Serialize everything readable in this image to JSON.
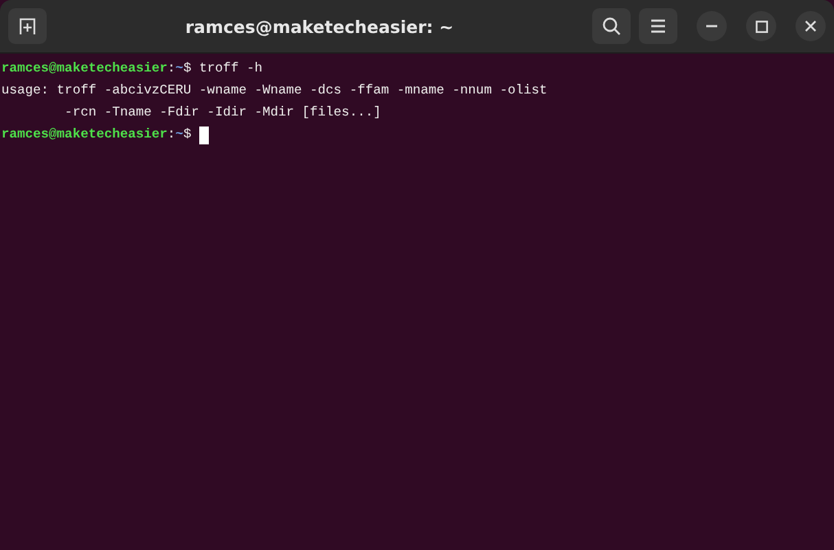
{
  "window": {
    "title": "ramces@maketecheasier: ~"
  },
  "lines": [
    {
      "kind": "prompt",
      "user_host": "ramces@maketecheasier",
      "separator": ":",
      "path": "~",
      "symbol": "$",
      "command": "troff -h"
    },
    {
      "kind": "output",
      "text": "usage: troff -abcivzCERU -wname -Wname -dcs -ffam -mname -nnum -olist"
    },
    {
      "kind": "output",
      "text": "        -rcn -Tname -Fdir -Idir -Mdir [files...]"
    },
    {
      "kind": "prompt",
      "user_host": "ramces@maketecheasier",
      "separator": ":",
      "path": "~",
      "symbol": "$",
      "cursor": true
    }
  ]
}
